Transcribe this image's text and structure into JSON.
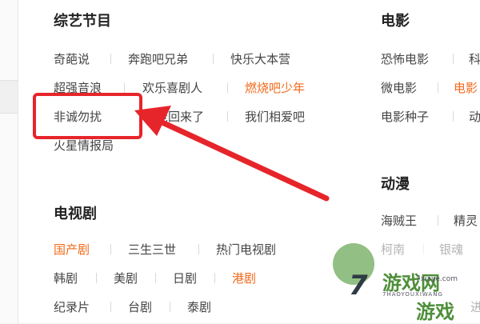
{
  "variety": {
    "title": "综艺节目",
    "links": [
      "奇葩说",
      "奔跑吧兄弟",
      "快乐大本营",
      "超强音浪",
      "欢乐喜剧人",
      "燃烧吧少年",
      "非诚勿扰",
      "爸爸回来了",
      "我们相爱吧",
      "火星情报局"
    ]
  },
  "movie": {
    "title": "电影",
    "links": [
      "恐怖电影",
      "科",
      "微电影",
      "电影",
      "电影种子",
      "动"
    ]
  },
  "tv": {
    "title": "电视剧",
    "links": [
      "国产剧",
      "三生三世",
      "热门电视剧",
      "韩剧",
      "美剧",
      "日剧",
      "港剧",
      "纪录片",
      "台剧",
      "泰剧"
    ]
  },
  "anime": {
    "title": "动漫",
    "links": [
      "海贼王",
      "精灵",
      "柯南",
      "银魂",
      "进"
    ]
  },
  "watermark": {
    "number": "7",
    "big1": "游戏网",
    "small": "7HAOYOUXIWANG",
    "big2": "游戏",
    "domain": "7xiaye.com"
  },
  "colors": {
    "highlight": "#f26a1b",
    "annotation": "#e6252b"
  }
}
